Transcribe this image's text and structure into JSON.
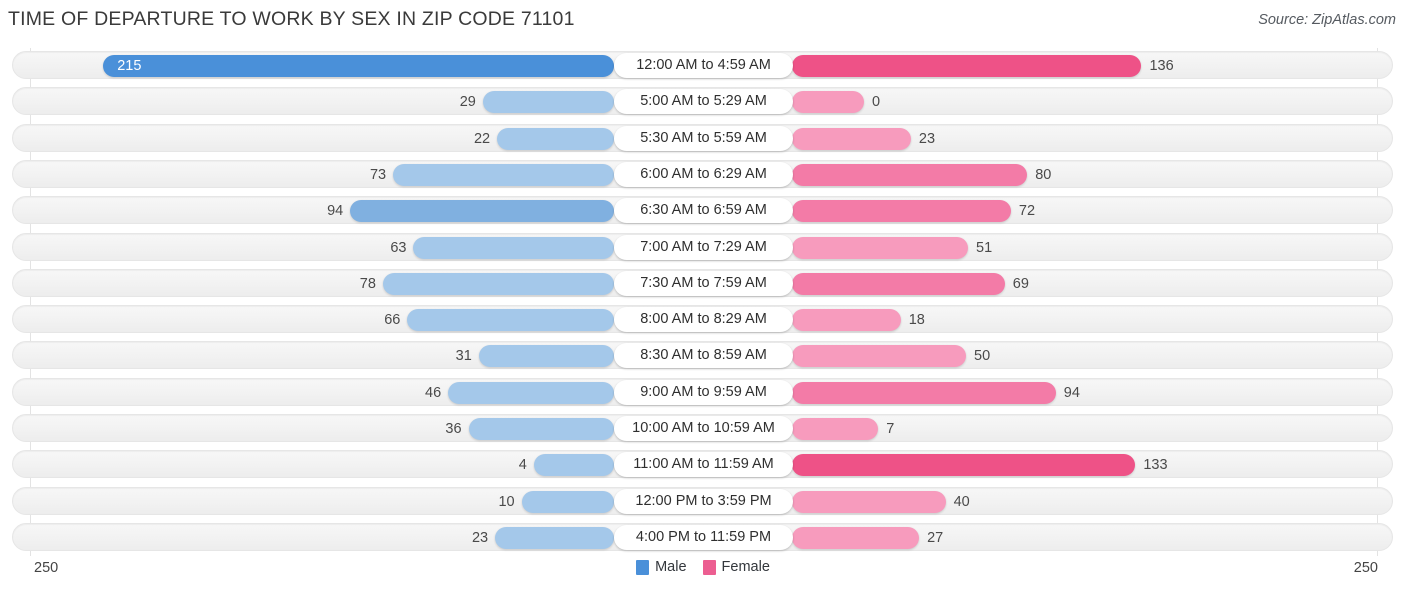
{
  "header": {
    "title": "TIME OF DEPARTURE TO WORK BY SEX IN ZIP CODE 71101",
    "source": "Source: ZipAtlas.com"
  },
  "legend": {
    "male_label": "Male",
    "female_label": "Female",
    "male_color": "#4a90d9",
    "female_color": "#ec5e91"
  },
  "axis": {
    "left_max": "250",
    "right_max": "250"
  },
  "chart_data": {
    "type": "bar",
    "subtype": "diverging-bar",
    "title": "TIME OF DEPARTURE TO WORK BY SEX IN ZIP CODE 71101",
    "xlabel": "",
    "ylabel": "",
    "xlim": [
      0,
      250
    ],
    "grid": true,
    "legend_position": "bottom-center",
    "categories": [
      "12:00 AM to 4:59 AM",
      "5:00 AM to 5:29 AM",
      "5:30 AM to 5:59 AM",
      "6:00 AM to 6:29 AM",
      "6:30 AM to 6:59 AM",
      "7:00 AM to 7:29 AM",
      "7:30 AM to 7:59 AM",
      "8:00 AM to 8:29 AM",
      "8:30 AM to 8:59 AM",
      "9:00 AM to 9:59 AM",
      "10:00 AM to 10:59 AM",
      "11:00 AM to 11:59 AM",
      "12:00 PM to 3:59 PM",
      "4:00 PM to 11:59 PM"
    ],
    "series": [
      {
        "name": "Male",
        "color": "#4a90d9",
        "side": "left",
        "values": [
          215,
          29,
          22,
          73,
          94,
          63,
          78,
          66,
          31,
          46,
          36,
          4,
          10,
          23
        ]
      },
      {
        "name": "Female",
        "color": "#ec5e91",
        "side": "right",
        "values": [
          136,
          0,
          23,
          80,
          72,
          51,
          69,
          18,
          50,
          94,
          7,
          133,
          40,
          27
        ]
      }
    ]
  }
}
